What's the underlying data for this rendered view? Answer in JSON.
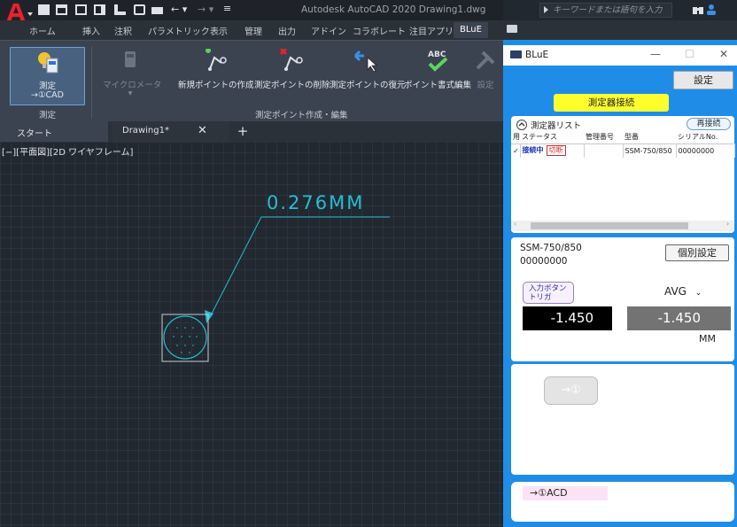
{
  "titlebar": {
    "title": "Autodesk AutoCAD 2020   Drawing1.dwg",
    "search_placeholder": "キーワードまたは語句を入力"
  },
  "ribbon_tabs": [
    "ホーム",
    "挿入",
    "注釈",
    "パラメトリック",
    "表示",
    "管理",
    "出力",
    "アドイン",
    "コラボレート",
    "注目アプリ",
    "BLuE"
  ],
  "ribbon": {
    "measure_label_1": "測定",
    "measure_label_2": "→①CAD",
    "micrometer_label": "マイクロメータ",
    "new_point": "新規ポイントの作成",
    "delete_point": "測定ポイントの削除",
    "restore_point": "測定ポイントの復元",
    "edit_format": "ポイント書式編集",
    "settings": "設定",
    "group_measure": "測定",
    "group_edit": "測定ポイント作成・編集"
  },
  "doc_tabs": {
    "start": "スタート",
    "drawing": "Drawing1*"
  },
  "viewport_controls": "[−][平面図][2D ワイヤフレーム]",
  "drawing": {
    "dimension_text": "0.276MM"
  },
  "blue": {
    "title": "BLuE",
    "settings_btn": "設定",
    "connect_btn": "測定器接続",
    "device_list_title": "測定器リスト",
    "reconnect_btn": "再接続",
    "table_headers": [
      "用",
      "ステータス",
      "管理番号",
      "型番",
      "シリアルNo."
    ],
    "table_row": {
      "status": "接続中",
      "disconnect": "切断",
      "mgmt": "",
      "model": "SSM-750/850",
      "serial": "00000000"
    },
    "model_label": "SSM-750/850",
    "serial_label": "00000000",
    "indiv_settings_btn": "個別設定",
    "trigger_btn_line1": "入力ボタン",
    "trigger_btn_line2": "トリガ",
    "avg_select": "AVG",
    "value_current": "-1.450",
    "value_avg": "-1.450",
    "unit": "MM",
    "send_btn": "→①",
    "footer_label": "→①ACD"
  },
  "colors": {
    "accent_blue": "#1f8de8",
    "connect_yellow": "#ffff2e",
    "dimension_cyan": "#29bcd1"
  }
}
